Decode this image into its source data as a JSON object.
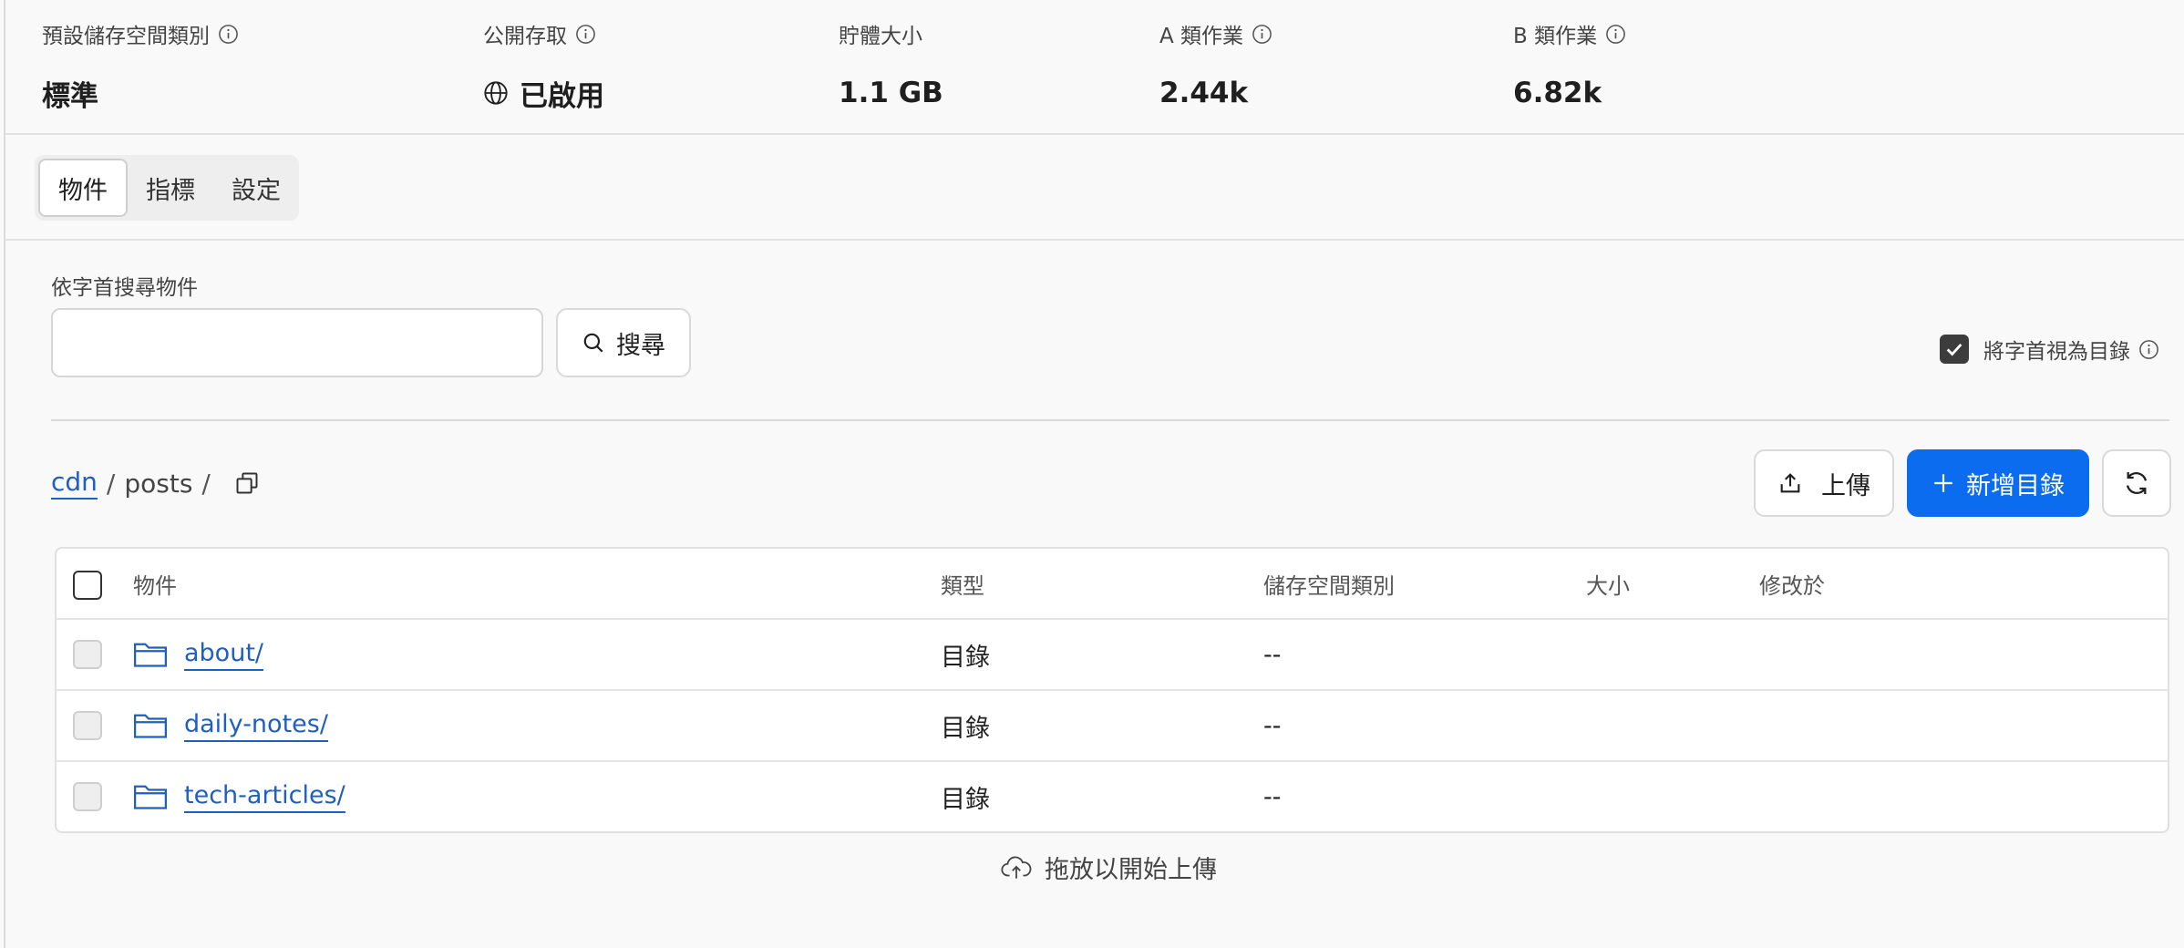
{
  "stats": [
    {
      "label": "預設儲存空間類別",
      "value": "標準",
      "info": true
    },
    {
      "label": "公開存取",
      "value": "已啟用",
      "info": true,
      "icon": "globe-icon"
    },
    {
      "label": "貯體大小",
      "value": "1.1 GB",
      "info": false
    },
    {
      "label": "A 類作業",
      "value": "2.44k",
      "info": true
    },
    {
      "label": "B 類作業",
      "value": "6.82k",
      "info": true
    }
  ],
  "tabs": [
    {
      "label": "物件",
      "active": true
    },
    {
      "label": "指標",
      "active": false
    },
    {
      "label": "設定",
      "active": false
    }
  ],
  "search": {
    "label": "依字首搜尋物件",
    "value": "",
    "button_label": "搜尋"
  },
  "prefix_toggle": {
    "label": "將字首視為目錄",
    "checked": true
  },
  "breadcrumb": {
    "root": "cdn",
    "sep1": "/",
    "current": "posts",
    "sep2": "/"
  },
  "actions": {
    "upload_label": "上傳",
    "new_dir_label": "新增目錄"
  },
  "table": {
    "columns": [
      "物件",
      "類型",
      "儲存空間類別",
      "大小",
      "修改於"
    ],
    "rows": [
      {
        "name": "about/",
        "type": "目錄",
        "storage_class": "--",
        "size": "",
        "modified": ""
      },
      {
        "name": "daily-notes/",
        "type": "目錄",
        "storage_class": "--",
        "size": "",
        "modified": ""
      },
      {
        "name": "tech-articles/",
        "type": "目錄",
        "storage_class": "--",
        "size": "",
        "modified": ""
      }
    ]
  },
  "dropzone": {
    "label": "拖放以開始上傳"
  },
  "colors": {
    "accent": "#0b6cf0",
    "link": "#1f5fbf",
    "background": "#f9f9f9"
  }
}
